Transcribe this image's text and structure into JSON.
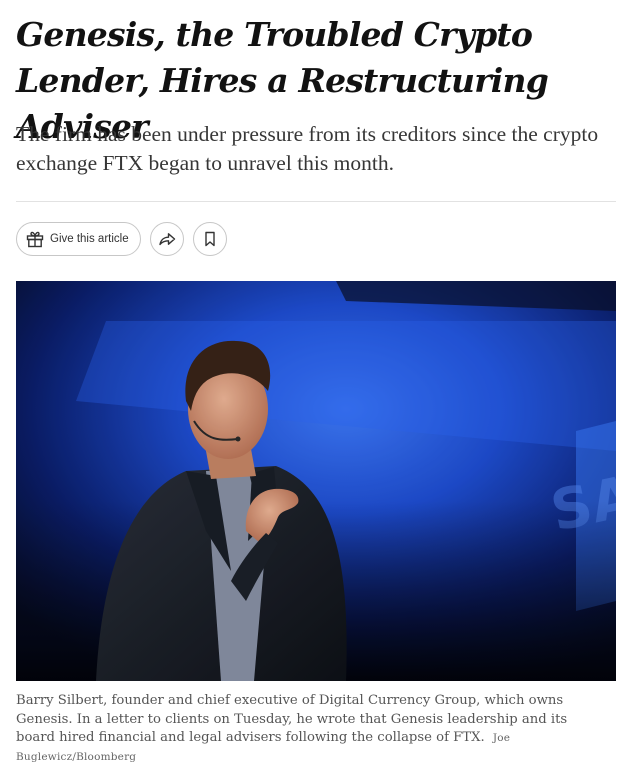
{
  "article": {
    "headline": "Genesis, the Troubled Crypto Lender, Hires a Restructuring Adviser",
    "summary": "The firm has been under pressure from its creditors since the crypto exchange FTX began to unravel this month."
  },
  "share_bar": {
    "gift_label": "Give this article",
    "gift_icon": "gift-icon",
    "share_icon": "share-arrow-icon",
    "save_icon": "bookmark-icon"
  },
  "photo": {
    "caption": "Barry Silbert, founder and chief executive of Digital Currency Group, which owns Genesis. In a letter to clients on Tuesday, he wrote that Genesis leadership and its board hired financial and legal advisers following the collapse of FTX.",
    "credit": "Joe Buglewicz/Bloomberg"
  },
  "colors": {
    "text": "#121212",
    "summary_text": "#363636",
    "caption_text": "#555555",
    "stage_blue": "#1f4fd6",
    "border": "#c7c7c7"
  }
}
